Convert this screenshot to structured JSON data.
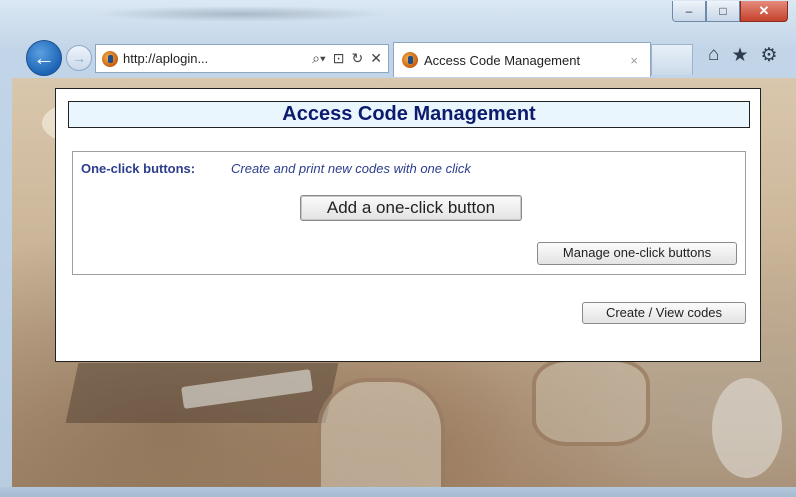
{
  "browser": {
    "address": "http://aplogin...",
    "address_controls": [
      "⌕▾",
      "⊡",
      "↻",
      "✕"
    ],
    "tab_title": "Access Code Management",
    "tab_close": "×",
    "window_controls": {
      "minimize": "–",
      "maximize": "□",
      "close": "✕"
    },
    "tools": [
      "⌂",
      "★",
      "⚙"
    ]
  },
  "page": {
    "title": "Access Code Management",
    "oneclick": {
      "label": "One-click buttons:",
      "description": "Create and print new codes with one click",
      "add_button": "Add a one-click button",
      "manage_button": "Manage one-click buttons"
    },
    "create_view_button": "Create / View codes"
  },
  "colors": {
    "title_text": "#0d1b6e",
    "title_bg": "#e9f6fd",
    "label_text": "#2c3d8d"
  }
}
